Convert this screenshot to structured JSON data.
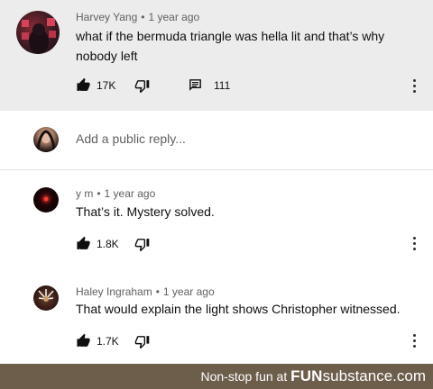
{
  "top_comment": {
    "author": "Harvey Yang",
    "time": "1 year ago",
    "text_line1": "what if the bermuda triangle was hella lit and that’s why",
    "text_line2": "nobody left",
    "likes": "17K",
    "replies": "111"
  },
  "reply_box": {
    "placeholder": "Add a public reply..."
  },
  "replies": [
    {
      "author": "y m",
      "time": "1 year ago",
      "text": "That’s it. Mystery solved.",
      "likes": "1.8K"
    },
    {
      "author": "Haley Ingraham",
      "time": "1 year ago",
      "text": "That would explain the light shows Christopher witnessed.",
      "likes": "1.7K"
    }
  ],
  "footer": {
    "prefix": "Non-stop fun at ",
    "brand_bold": "FUN",
    "brand_rest": "substance.com"
  },
  "separator": "•",
  "colors": {
    "top_bg": "#ececec",
    "footer_bg": "#6d5d4b",
    "meta": "#606060"
  }
}
